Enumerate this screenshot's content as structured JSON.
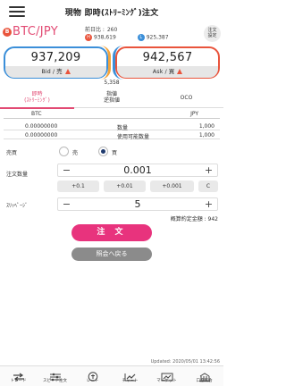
{
  "header": {
    "title": "現物 即時(ｽﾄﾘｰﾐﾝｸﾞ)注文"
  },
  "pair": {
    "icon_letter": "B",
    "name": "BTC/JPY",
    "prev_label": "前日比 :",
    "prev_value": "260",
    "high_badge": "H",
    "high": "938,619",
    "low_badge": "L",
    "low": "925,387",
    "settings_label_1": "注文",
    "settings_label_2": "設定"
  },
  "prices": {
    "bid_price": "937,209",
    "bid_label": "Bid / 売",
    "ask_price": "942,567",
    "ask_label": "Ask / 買",
    "spread": "5,358"
  },
  "tabs": [
    {
      "line1": "即時",
      "line2": "(ｽﾄﾘｰﾐﾝｸﾞ)"
    },
    {
      "line1": "指値",
      "line2": "逆指値"
    },
    {
      "line1": "OCO",
      "line2": ""
    }
  ],
  "balances": {
    "header_left": "BTC",
    "header_right": "JPY",
    "rows": [
      {
        "btc": "0.00000000",
        "label": "数量",
        "jpy": "1,000"
      },
      {
        "btc": "0.00000000",
        "label": "使用可能数量",
        "jpy": "1,000"
      }
    ]
  },
  "order": {
    "side_label": "売買",
    "sell_label": "売",
    "buy_label": "買",
    "selected_side": "buy",
    "qty_label": "注文数量",
    "qty_value": "0.001",
    "chips": [
      "+0.1",
      "+0.01",
      "+0.001",
      "C"
    ],
    "slippage_label": "ｽﾘｯﾍﾟｰｼﾞ",
    "slippage_value": "5",
    "minus": "−",
    "plus": "+",
    "margin_text": "概算約定金額 : 942",
    "submit_label": "注 文",
    "back_label": "照会へ戻る"
  },
  "updated": "Updated: 2020/05/01 13:42:56",
  "nav": [
    {
      "label": "トレード",
      "icon": "trade-icon"
    },
    {
      "label": "スピード注文",
      "icon": "speed-order-icon"
    },
    {
      "label": "レート",
      "icon": "rate-icon"
    },
    {
      "label": "チャート",
      "icon": "chart-icon"
    },
    {
      "label": "マーケット",
      "icon": "market-icon"
    },
    {
      "label": "口座照会",
      "icon": "account-icon"
    }
  ]
}
